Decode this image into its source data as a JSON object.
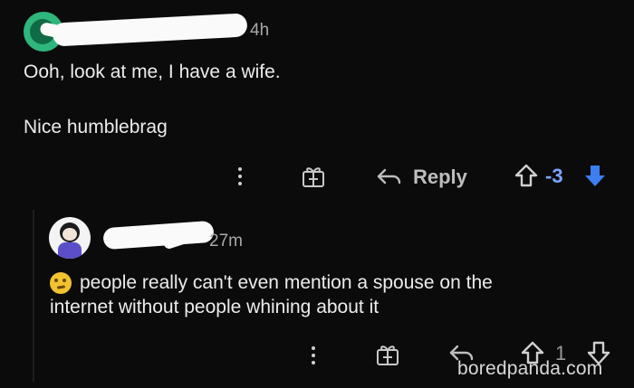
{
  "comment": {
    "time": "4h",
    "body_line1": "Ooh, look at me, I have a wife.",
    "body_line2": "Nice humblebrag",
    "reply_label": "Reply",
    "score": "-3"
  },
  "reply": {
    "time_suffix": "27m",
    "body_line1": "people really can't even mention a spouse on the",
    "body_line2": "internet without people whining about it",
    "score": "1"
  },
  "watermark": "boredpanda.com",
  "colors": {
    "background": "#0b0b0b",
    "text": "#ececec",
    "muted": "#a8a8a8",
    "vote_blue": "#7aa6ff",
    "downvote_active": "#3d7ef0",
    "avatar_green": "#2fb67c"
  },
  "icons": {
    "avatar1": "snoo-avatar-icon",
    "more": "more-options-icon",
    "gift": "award-gift-icon",
    "reply": "reply-arrow-icon",
    "upvote": "upvote-arrow-icon",
    "downvote": "downvote-arrow-icon",
    "emoji": "smirk-emoji-icon"
  }
}
